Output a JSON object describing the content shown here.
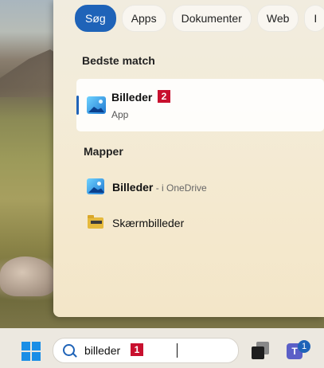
{
  "search_tabs": [
    "Søg",
    "Apps",
    "Dokumenter",
    "Web",
    "I"
  ],
  "best_match": {
    "heading": "Bedste match",
    "app_name": "Billeder",
    "app_type": "App",
    "badge": "2"
  },
  "folders": {
    "heading": "Mapper",
    "items": [
      {
        "name": "Billeder",
        "location": " - i OneDrive",
        "icon": "photos-icon"
      },
      {
        "name": "Skærmbilleder",
        "location": "",
        "icon": "folder-icon"
      }
    ]
  },
  "taskbar": {
    "search_query": "billeder",
    "search_badge": "1",
    "teams_letter": "T",
    "teams_notification_count": "1",
    "icons": [
      "windows-start-icon",
      "search-icon",
      "task-view-icon",
      "teams-icon"
    ]
  },
  "colors": {
    "accent": "#1f63b8",
    "badge": "#c8102e"
  }
}
